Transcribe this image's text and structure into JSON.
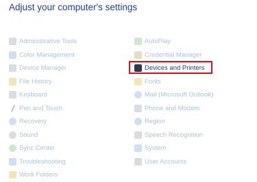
{
  "header": {
    "title": "Adjust your computer's settings"
  },
  "left_items": [
    {
      "label": "Administrative Tools",
      "icon": "administrative-tools-icon"
    },
    {
      "label": "Color Management",
      "icon": "color-management-icon"
    },
    {
      "label": "Device Manager",
      "icon": "device-manager-icon"
    },
    {
      "label": "File History",
      "icon": "file-history-icon"
    },
    {
      "label": "Keyboard",
      "icon": "keyboard-icon"
    },
    {
      "label": "Pen and Touch",
      "icon": "pen-icon"
    },
    {
      "label": "Recovery",
      "icon": "recovery-icon"
    },
    {
      "label": "Sound",
      "icon": "sound-icon"
    },
    {
      "label": "Sync Center",
      "icon": "sync-center-icon"
    },
    {
      "label": "Troubleshooting",
      "icon": "troubleshooting-icon"
    },
    {
      "label": "Work Folders",
      "icon": "work-folders-icon"
    }
  ],
  "right_items": [
    {
      "label": "AutoPlay",
      "icon": "autoplay-icon"
    },
    {
      "label": "Credential Manager",
      "icon": "credential-manager-icon"
    },
    {
      "label": "Devices and Printers",
      "icon": "devices-and-printers-icon"
    },
    {
      "label": "Fonts",
      "icon": "fonts-icon"
    },
    {
      "label": "Mail (Microsoft Outlook)",
      "icon": "mail-icon"
    },
    {
      "label": "Phone and Modem",
      "icon": "phone-and-modem-icon"
    },
    {
      "label": "Region",
      "icon": "region-icon"
    },
    {
      "label": "Speech Recognition",
      "icon": "speech-recognition-icon"
    },
    {
      "label": "System",
      "icon": "system-icon"
    },
    {
      "label": "User Accounts",
      "icon": "user-accounts-icon"
    }
  ],
  "colors": {
    "title": "#1e3f9c",
    "faded_item": "#a9c4de",
    "active_item": "#1f3a8a",
    "highlight_border": "#e01010"
  }
}
